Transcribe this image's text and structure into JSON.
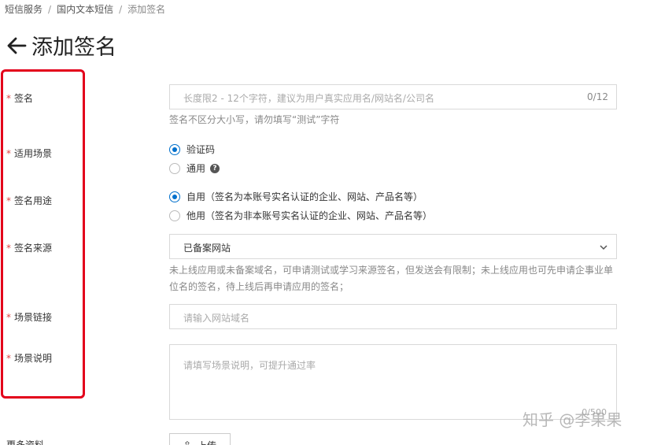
{
  "breadcrumb": {
    "item1": "短信服务",
    "item2": "国内文本短信",
    "current": "添加签名",
    "separator": "/"
  },
  "page": {
    "title": "添加签名"
  },
  "form": {
    "signature": {
      "label": "签名",
      "placeholder": "长度限2 - 12个字符，建议为用户真实应用名/网站名/公司名",
      "counter": "0/12",
      "help": "签名不区分大小写，请勿填写“测试”字符"
    },
    "scenario": {
      "label": "适用场景",
      "options": [
        {
          "label": "验证码",
          "selected": true
        },
        {
          "label": "通用",
          "selected": false
        }
      ]
    },
    "purpose": {
      "label": "签名用途",
      "options": [
        {
          "label": "自用（签名为本账号实名认证的企业、网站、产品名等）",
          "selected": true
        },
        {
          "label": "他用（签名为非本账号实名认证的企业、网站、产品名等）",
          "selected": false
        }
      ]
    },
    "source": {
      "label": "签名来源",
      "value": "已备案网站",
      "help_line1": "未上线应用或未备案域名，可申请测试或学习来源签名，但发送会有限制；未上线应用也可先申请企事业单",
      "help_line2": "位名的签名，待上线后再申请应用的签名；"
    },
    "link": {
      "label": "场景链接",
      "placeholder": "请输入网站域名"
    },
    "description": {
      "label": "场景说明",
      "placeholder": "请填写场景说明，可提升通过率",
      "counter": "0/500"
    },
    "more": {
      "label": "更多资料",
      "upload_label": "上传"
    }
  },
  "watermark": "知乎 @李果果",
  "colors": {
    "accent": "#0070cc",
    "highlight": "#e3001b",
    "required": "#e04040"
  }
}
